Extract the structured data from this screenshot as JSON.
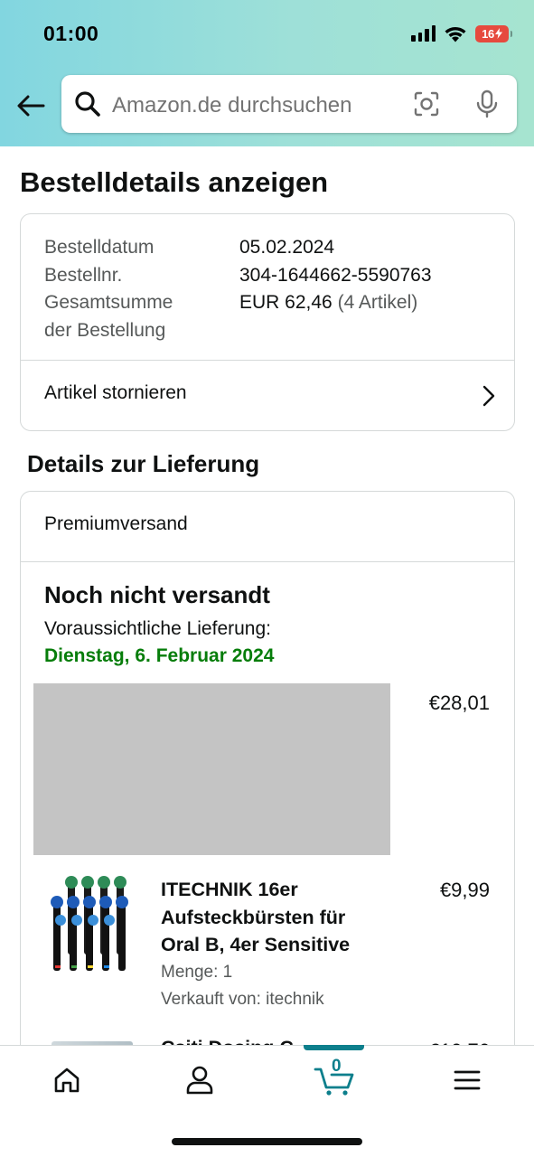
{
  "status_bar": {
    "time": "01:00",
    "battery": "16",
    "icons": [
      "signal-icon",
      "wifi-icon",
      "battery-icon"
    ]
  },
  "header": {
    "back_icon": "back-arrow-icon",
    "search": {
      "placeholder": "Amazon.de durchsuchen",
      "icons": [
        "search-icon",
        "camera-icon",
        "mic-icon"
      ]
    }
  },
  "page": {
    "title": "Bestelldetails anzeigen"
  },
  "order_summary": {
    "date_label": "Bestelldatum",
    "date_value": "05.02.2024",
    "number_label": "Bestellnr.",
    "number_value": "304-1644662-5590763",
    "total_label_line1": "Gesamtsumme",
    "total_label_line2": "der Bestellung",
    "total_value": "EUR 62,46",
    "total_items": "(4 Artikel)",
    "cancel_label": "Artikel stornieren"
  },
  "delivery": {
    "section_title": "Details zur Lieferung",
    "shipping_type": "Premiumversand",
    "status": "Noch nicht versandt",
    "expected_label": "Voraussichtliche Lieferung:",
    "expected_date": "Dienstag, 6. Februar 2024",
    "date_color": "#067d0a",
    "items": [
      {
        "price": "€28,01"
      },
      {
        "title": "ITECHNIK 16er Aufsteckbürsten für Oral B, 4er Sensitive",
        "title_line1": "ITECHNIK 16er",
        "title_line2": "Aufsteckbürsten für",
        "title_line3": "Oral B, 4er Sensitive",
        "quantity": "Menge: 1",
        "seller": "Verkauft von: itechnik",
        "price": "€9,99"
      },
      {
        "title_partial": "Csiti Dosing C",
        "price_partial": "€10,76"
      }
    ]
  },
  "bottom_nav": {
    "items": [
      "home-icon",
      "account-icon",
      "cart-icon",
      "menu-icon"
    ],
    "cart_count": "0",
    "accent_color": "#0d7f8c"
  }
}
